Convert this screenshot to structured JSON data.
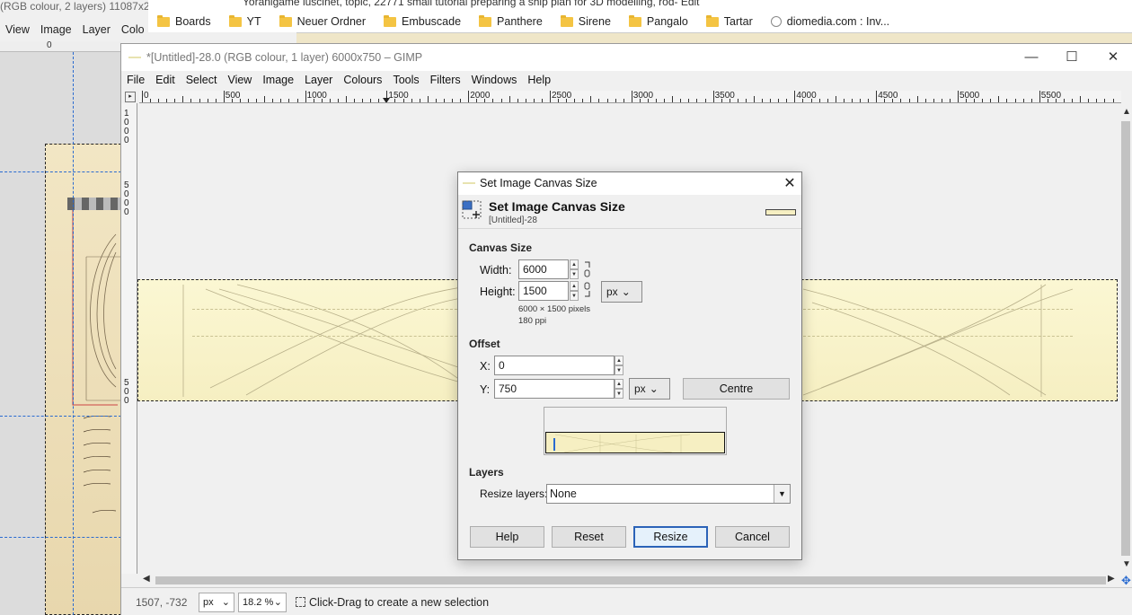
{
  "background_window": {
    "title": "(RGB colour, 2 layers) 11087x2",
    "menu": [
      "View",
      "Image",
      "Layer",
      "Colo"
    ],
    "ruler_zero": "0"
  },
  "browser": {
    "tab_text": "Yoranigame luscinet, topic, 22771 small tutorial preparing a ship plan for 3D modelling, rod- Edit",
    "bookmarks": [
      {
        "label": "Boards",
        "icon": "folder-icon"
      },
      {
        "label": "YT",
        "icon": "folder-icon"
      },
      {
        "label": "Neuer Ordner",
        "icon": "folder-icon"
      },
      {
        "label": "Embuscade",
        "icon": "folder-icon"
      },
      {
        "label": "Panthere",
        "icon": "folder-icon"
      },
      {
        "label": "Sirene",
        "icon": "folder-icon"
      },
      {
        "label": "Pangalo",
        "icon": "folder-icon"
      },
      {
        "label": "Tartar",
        "icon": "folder-icon"
      },
      {
        "label": "diomedia.com : Inv...",
        "icon": "site-icon"
      }
    ]
  },
  "main_window": {
    "title": "*[Untitled]-28.0 (RGB colour, 1 layer) 6000x750 – GIMP",
    "controls": {
      "minimize": "—",
      "maximize": "☐",
      "close": "✕"
    },
    "menu": [
      "File",
      "Edit",
      "Select",
      "View",
      "Image",
      "Layer",
      "Colours",
      "Tools",
      "Filters",
      "Windows",
      "Help"
    ],
    "ruler_labels": [
      "0",
      "500",
      "1000",
      "1500",
      "2000",
      "2500",
      "3000",
      "3500",
      "4000",
      "4500",
      "5000",
      "5500"
    ],
    "vruler_labels": [
      "1",
      "0",
      "0",
      "0",
      "5",
      "0",
      "0",
      "0",
      "5",
      "0",
      "0"
    ],
    "status": {
      "coords": "1507, -732",
      "unit": "px",
      "zoom": "18.2 %",
      "message": "Click-Drag to create a new selection"
    }
  },
  "dialog": {
    "title": "Set Image Canvas Size",
    "close": "✕",
    "heading": "Set Image Canvas Size",
    "subheading": "[Untitled]-28",
    "canvas_size": {
      "section": "Canvas Size",
      "width_label": "Width:",
      "width_value": "6000",
      "height_label": "Height:",
      "height_value": "1500",
      "unit": "px",
      "pixels_info": "6000 × 1500 pixels",
      "ppi_info": "180 ppi"
    },
    "offset": {
      "section": "Offset",
      "x_label": "X:",
      "x_value": "0",
      "y_label": "Y:",
      "y_value": "750",
      "unit": "px",
      "centre_button": "Centre"
    },
    "layers": {
      "section": "Layers",
      "resize_label": "Resize layers:",
      "resize_value": "None"
    },
    "buttons": {
      "help": "Help",
      "reset": "Reset",
      "resize": "Resize",
      "cancel": "Cancel"
    }
  }
}
